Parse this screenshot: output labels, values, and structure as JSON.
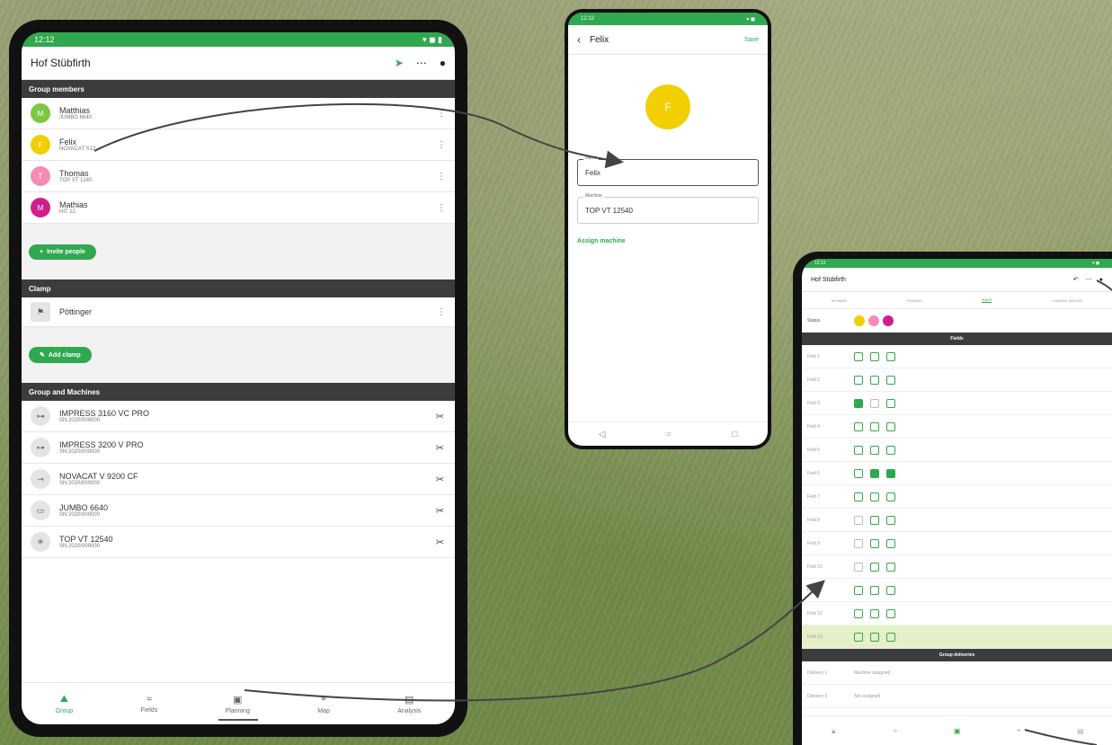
{
  "colors": {
    "accent": "#2fa84f",
    "section": "#3c3c3c",
    "yellow": "#f2cf00",
    "pink": "#f48cb4",
    "magenta": "#d21e8c",
    "lime": "#7bc843"
  },
  "main": {
    "title": "Hof Stübfirth",
    "sections": {
      "members": "Group members",
      "clamp": "Clamp",
      "machines": "Group and Machines"
    },
    "members": [
      {
        "name": "Matthias",
        "sub": "JUMBO 6640",
        "initial": "M",
        "color": "#7bc843"
      },
      {
        "name": "Felix",
        "sub": "NOVACAT S12",
        "initial": "F",
        "color": "#f2cf00"
      },
      {
        "name": "Thomas",
        "sub": "TOP VT 1240",
        "initial": "T",
        "color": "#f48cb4"
      },
      {
        "name": "Mathias",
        "sub": "HIT 12",
        "initial": "M",
        "color": "#d21e8c"
      }
    ],
    "invite_label": "Invite people",
    "clamp_item": "Pöttinger",
    "add_clamp_label": "Add clamp",
    "machines": [
      {
        "name": "IMPRESS 3160 VC PRO",
        "sub": "SN 2020/000000",
        "icon": "baler-icon"
      },
      {
        "name": "IMPRESS 3200 V PRO",
        "sub": "SN 2020/000000",
        "icon": "baler-icon"
      },
      {
        "name": "NOVACAT V 9200 CF",
        "sub": "SN 2020/000000",
        "icon": "mower-icon"
      },
      {
        "name": "JUMBO 6640",
        "sub": "SN 2020/000000",
        "icon": "wagon-icon"
      },
      {
        "name": "TOP VT 12540",
        "sub": "SN 2020/000000",
        "icon": "rake-icon"
      }
    ],
    "nav": [
      {
        "label": "Group",
        "icon": "group-icon",
        "active": true
      },
      {
        "label": "Fields",
        "icon": "fields-icon"
      },
      {
        "label": "Planning",
        "icon": "planning-icon"
      },
      {
        "label": "Map",
        "icon": "map-icon"
      },
      {
        "label": "Analysis",
        "icon": "analysis-icon"
      }
    ]
  },
  "felix": {
    "back_title": "Felix",
    "save_label": "Save",
    "avatar_initial": "F",
    "name_label": "Name",
    "name_value": "Felix",
    "machine_label": "Machine",
    "machine_value": "TOP VT 12540",
    "assign_label": "Assign machine"
  },
  "planning": {
    "title": "Hof Stübfirth",
    "tabs": [
      "MOWING",
      "TEDDING",
      "RAKE",
      "LOADING WAGON"
    ],
    "people_label": "Status",
    "group_header": "Fields",
    "second_header": "Group deliveries",
    "rows": [
      {
        "name": "Feld 1",
        "checks": [
          1,
          0,
          0
        ]
      },
      {
        "name": "Feld 2",
        "checks": [
          1,
          0,
          0
        ]
      },
      {
        "name": "Feld 3",
        "checks": [
          2,
          3,
          0
        ]
      },
      {
        "name": "Feld 4",
        "checks": [
          1,
          0,
          0
        ]
      },
      {
        "name": "Feld 5",
        "checks": [
          1,
          0,
          0
        ]
      },
      {
        "name": "Feld 6",
        "checks": [
          0,
          2,
          2
        ]
      },
      {
        "name": "Feld 7",
        "checks": [
          1,
          0,
          0
        ]
      },
      {
        "name": "Feld 8",
        "checks": [
          3,
          1,
          0
        ]
      },
      {
        "name": "Feld 9",
        "checks": [
          3,
          0,
          0
        ]
      },
      {
        "name": "Feld 10",
        "checks": [
          3,
          0,
          0
        ]
      },
      {
        "name": "Feld 11",
        "checks": [
          0,
          0,
          0
        ]
      },
      {
        "name": "Feld 12",
        "checks": [
          1,
          0,
          0
        ]
      },
      {
        "name": "Feld 13",
        "checks": [
          1,
          0,
          0
        ]
      }
    ],
    "delivery_rows": [
      {
        "a": "Delivery 1",
        "b": "Machine assigned"
      },
      {
        "a": "Delivery 2",
        "b": "Not assigned"
      }
    ]
  }
}
